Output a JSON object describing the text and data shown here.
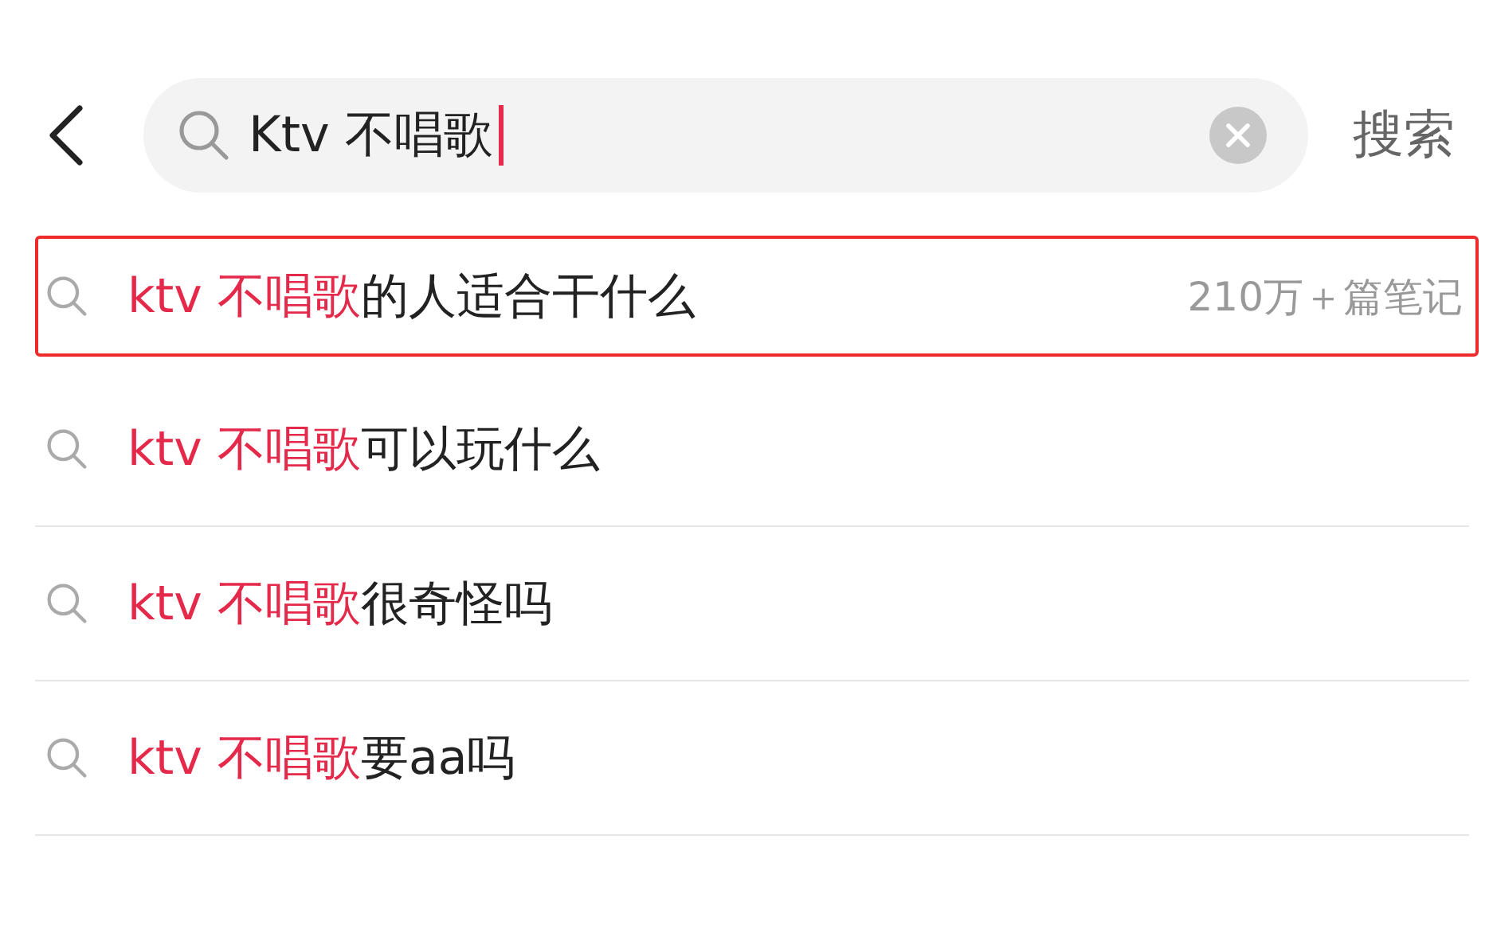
{
  "search": {
    "value": "Ktv 不唱歌",
    "submit_label": "搜索"
  },
  "suggestions": [
    {
      "match": "ktv 不唱歌",
      "rest": "的人适合干什么",
      "count": "210万＋篇笔记",
      "selected": true
    },
    {
      "match": "ktv 不唱歌",
      "rest": "可以玩什么",
      "selected": false
    },
    {
      "match": "ktv 不唱歌",
      "rest": "很奇怪吗",
      "selected": false
    },
    {
      "match": "ktv 不唱歌",
      "rest": "要aa吗",
      "selected": false
    }
  ]
}
